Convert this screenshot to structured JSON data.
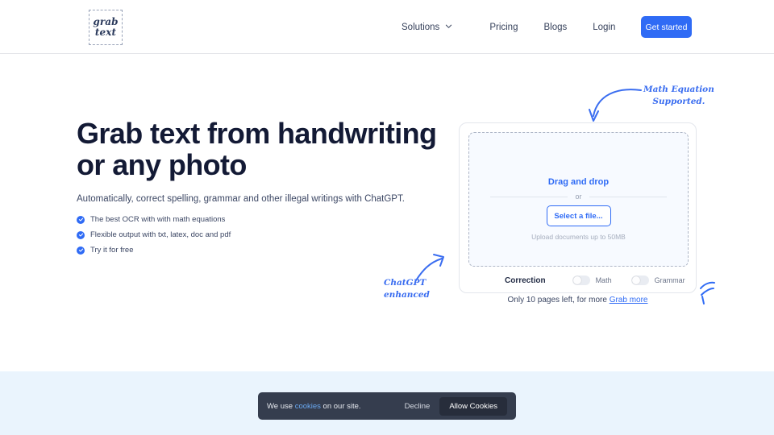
{
  "header": {
    "logo": {
      "line1": "grab",
      "line2": "text"
    },
    "nav": [
      {
        "label": "Solutions",
        "has_chevron": true,
        "icon": "chevron-down-icon"
      },
      {
        "label": "Pricing",
        "has_chevron": false
      },
      {
        "label": "Blogs",
        "has_chevron": false
      },
      {
        "label": "Login",
        "has_chevron": false
      }
    ],
    "cta": {
      "label": "Get started",
      "color": "#2f6bf5"
    }
  },
  "hero": {
    "title": "Grab text from handwriting or any photo",
    "subtitle": "Automatically, correct spelling, grammar and other illegal writings with ChatGPT.",
    "features": [
      {
        "label": "The best OCR with with math equations",
        "icon": "check-circle-icon"
      },
      {
        "label": "Flexible output with txt, latex, doc and pdf",
        "icon": "check-circle-icon"
      },
      {
        "label": "Try it for free",
        "icon": "check-circle-icon"
      }
    ]
  },
  "upload_card": {
    "dropzone": {
      "title": "Drag and drop",
      "or": "or",
      "select_button": "Select a file...",
      "note": "Upload documents up to 50MB"
    },
    "correction": {
      "label": "Correction",
      "toggles": [
        {
          "label": "Math",
          "state": "off"
        },
        {
          "label": "Grammar",
          "state": "off"
        }
      ]
    },
    "footer": {
      "text": "Only 10 pages left, for more ",
      "link": "Grab more"
    }
  },
  "annotations": {
    "math": {
      "line1": "Math Equation",
      "line2": "Supported.",
      "color": "#3a6df0"
    },
    "chatgpt": {
      "line1": "ChatGPT",
      "line2": "enhanced",
      "color": "#3a6df0"
    }
  },
  "cookie_banner": {
    "text_before": "We use ",
    "link": "cookies",
    "text_after": " on our site.",
    "decline": "Decline",
    "allow": "Allow Cookies"
  }
}
